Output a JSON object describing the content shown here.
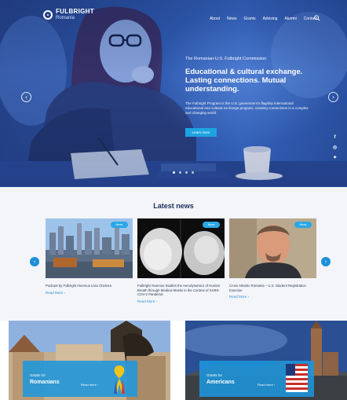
{
  "header": {
    "logo_title": "FULBRIGHT",
    "logo_subtitle": "Romania",
    "nav": [
      "About",
      "News",
      "Grants",
      "Advising",
      "Alumni",
      "Contact"
    ]
  },
  "hero": {
    "subtitle": "The Romanian-U.S. Fulbright Commission",
    "title": "Educational & cultural exchange. Lasting connections. Mutual understanding.",
    "body": "The Fulbright Program is the U.S. government's flagship international educational and cultural exchange program, creating connections in a complex and changing world.",
    "button": "Learn more",
    "prev": "‹",
    "next": "›",
    "social": [
      "f",
      "◎",
      "✦"
    ]
  },
  "news": {
    "heading": "Latest news",
    "prev": "‹",
    "next": "›",
    "items": [
      {
        "badge": "News",
        "caption": "Podcast by Fulbright Alumnus Liviu Chelcea",
        "more": "Read More ›"
      },
      {
        "badge": "News",
        "caption": "Fulbright Alumnus Studies the Aerodynamics of Human Breath through Medical Masks in the Context of SARS-COV-2 Pandemic",
        "more": "Read More ›"
      },
      {
        "badge": "News",
        "caption": "Cross Atlantic Romania – U.S. Student Registration Exercise",
        "more": "Read More ›"
      }
    ]
  },
  "tiles": [
    {
      "small": "Grants for",
      "title": "Romanians",
      "more": "Read more ›"
    },
    {
      "small": "Grants for",
      "title": "Americans",
      "more": "Read more ›"
    }
  ],
  "colors": {
    "accent": "#1fa3e0",
    "hero_blue": "#2f5bb2",
    "heading": "#1c2d5a"
  }
}
